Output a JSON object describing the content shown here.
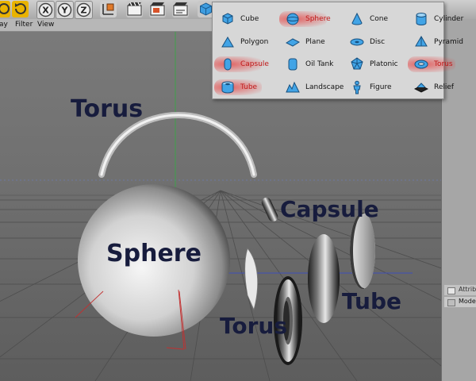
{
  "toolbar": {
    "buttons": [
      {
        "icon": "undo-icon"
      },
      {
        "icon": "redo-icon"
      },
      {
        "icon": "x-axis-lock-icon",
        "glyph": "X"
      },
      {
        "icon": "y-axis-lock-icon",
        "glyph": "Y"
      },
      {
        "icon": "z-axis-lock-icon",
        "glyph": "Z"
      },
      {
        "icon": "coordinate-system-icon"
      },
      {
        "icon": "render-view-icon"
      },
      {
        "icon": "render-picture-viewer-icon"
      },
      {
        "icon": "render-settings-icon"
      },
      {
        "icon": "add-cube-icon"
      }
    ]
  },
  "menubar": {
    "items": [
      "ay",
      "Filter",
      "View"
    ]
  },
  "popup": {
    "columns": [
      [
        {
          "label": "Cube",
          "icon": "cube-icon",
          "highlighted": false
        },
        {
          "label": "Polygon",
          "icon": "polygon-icon",
          "highlighted": false
        },
        {
          "label": "Capsule",
          "icon": "capsule-icon",
          "highlighted": true
        },
        {
          "label": "Tube",
          "icon": "tube-icon",
          "highlighted": true
        }
      ],
      [
        {
          "label": "Sphere",
          "icon": "sphere-icon",
          "highlighted": true
        },
        {
          "label": "Plane",
          "icon": "plane-icon",
          "highlighted": false
        },
        {
          "label": "Oil Tank",
          "icon": "oil-tank-icon",
          "highlighted": false
        },
        {
          "label": "Landscape",
          "icon": "landscape-icon",
          "highlighted": false
        }
      ],
      [
        {
          "label": "Cone",
          "icon": "cone-icon",
          "highlighted": false
        },
        {
          "label": "Disc",
          "icon": "disc-icon",
          "highlighted": false
        },
        {
          "label": "Platonic",
          "icon": "platonic-icon",
          "highlighted": false
        },
        {
          "label": "Figure",
          "icon": "figure-icon",
          "highlighted": false
        }
      ],
      [
        {
          "label": "Cylinder",
          "icon": "cylinder-icon",
          "highlighted": false
        },
        {
          "label": "Pyramid",
          "icon": "pyramid-icon",
          "highlighted": false
        },
        {
          "label": "Torus",
          "icon": "torus-icon",
          "highlighted": true
        },
        {
          "label": "Relief",
          "icon": "relief-icon",
          "highlighted": false
        }
      ]
    ]
  },
  "viewport": {
    "labels": {
      "torus_top": "Torus",
      "sphere": "Sphere",
      "capsule": "Capsule",
      "torus_bottom": "Torus",
      "tube": "Tube"
    }
  },
  "right_panel": {
    "attributes_label": "Attribut",
    "mode_label": "Mode"
  },
  "colors": {
    "highlight": "#e63c3c",
    "label_text": "#171c3d",
    "icon_blue": "#2f8fd8"
  }
}
